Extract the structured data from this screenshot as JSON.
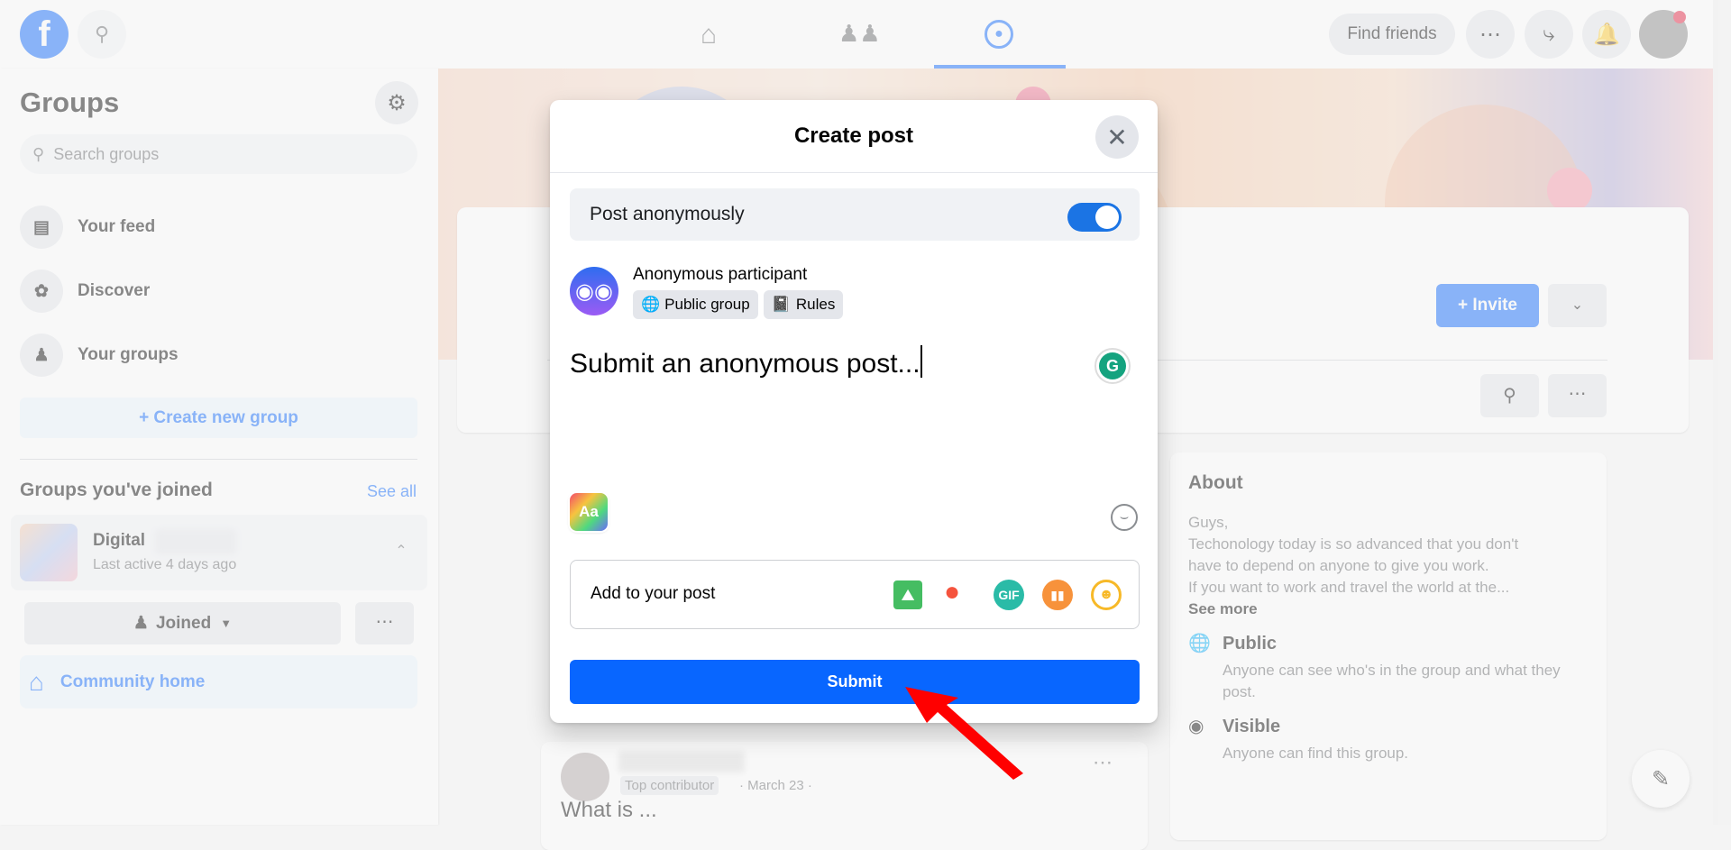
{
  "topbar": {
    "find_friends": "Find friends",
    "icons": [
      "facebook-logo",
      "search-icon",
      "home-icon",
      "friends-icon",
      "groups-icon",
      "menu-grid-icon",
      "messenger-icon",
      "bell-icon",
      "avatar"
    ]
  },
  "sidebar": {
    "title": "Groups",
    "search_placeholder": "Search groups",
    "items": [
      {
        "label": "Your feed",
        "icon": "feed-icon"
      },
      {
        "label": "Discover",
        "icon": "compass-icon"
      },
      {
        "label": "Your groups",
        "icon": "groups-icon"
      }
    ],
    "create_group": "+ Create new group",
    "joined_heading": "Groups you've joined",
    "see_all": "See all",
    "group": {
      "name": "Digital",
      "last_active": "Last active 4 days ago"
    },
    "joined_button": "Joined",
    "community_home": "Community home"
  },
  "group_header": {
    "invite": "+ Invite"
  },
  "about": {
    "title": "About",
    "description": [
      "Guys,",
      "Techonology today is so advanced that you don't",
      "have to depend on anyone to give you work.",
      "If you want to work and travel the world at the..."
    ],
    "see_more": "See more",
    "privacy_title": "Public",
    "privacy_desc": "Anyone can see who's in the group and what they post.",
    "visibility_title": "Visible",
    "visibility_desc": "Anyone can find this group."
  },
  "feed_post": {
    "badge": "Top contributor",
    "date": "· March 23 ·",
    "text": "What is ..."
  },
  "modal": {
    "title": "Create post",
    "anon_label": "Post anonymously",
    "anon_enabled": true,
    "author": "Anonymous participant",
    "audience": "Public group",
    "rules": "Rules",
    "text": "Submit an anonymous post...",
    "add_to_post": "Add to your post",
    "attachments": [
      "photo-icon",
      "location-icon",
      "gif-icon",
      "poll-icon",
      "feeling-icon"
    ],
    "submit": "Submit"
  },
  "colors": {
    "accent": "#0866ff",
    "toggle": "#1b74e4",
    "arrow": "#ff0000"
  }
}
